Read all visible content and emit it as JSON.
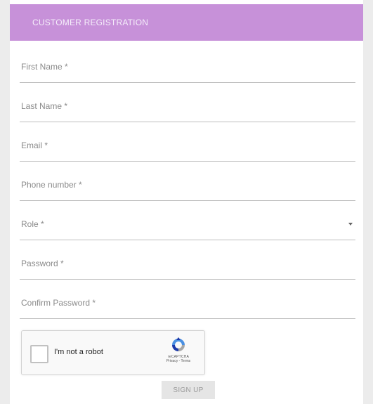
{
  "header": {
    "title": "CUSTOMER REGISTRATION"
  },
  "form": {
    "fields": [
      {
        "label": "First Name *"
      },
      {
        "label": "Last Name *"
      },
      {
        "label": "Email *"
      },
      {
        "label": "Phone number *"
      },
      {
        "label": "Role *",
        "type": "select"
      },
      {
        "label": "Password *"
      },
      {
        "label": "Confirm Password *"
      }
    ]
  },
  "recaptcha": {
    "label": "I'm not a robot",
    "brand": "reCAPTCHA",
    "links": "Privacy - Terms",
    "icon": "recaptcha-logo-icon"
  },
  "submit": {
    "label": "SIGN UP"
  },
  "colors": {
    "header_bg": "#c791d9",
    "page_bg": "#ececec",
    "button_bg": "#e5e5e5"
  }
}
